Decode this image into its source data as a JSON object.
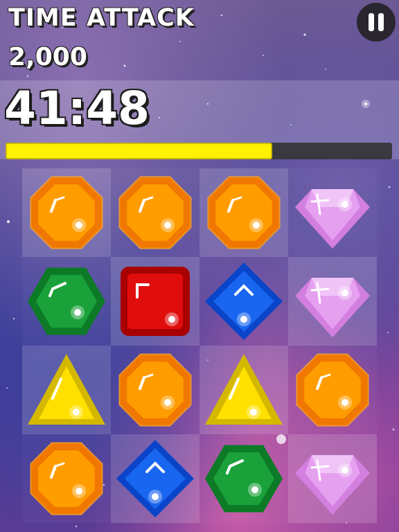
{
  "hud": {
    "title": "TIME ATTACK",
    "score": "2,000",
    "timer": "41:48",
    "time_remaining_fraction": 0.69
  },
  "colors": {
    "progress_fill": "#fff200",
    "orange_gem": "#ff9d00",
    "green_gem": "#1aa13a",
    "red_gem": "#e00d0d",
    "blue_gem": "#1966f0",
    "yellow_gem": "#ffe000",
    "pink_gem": "#e6a0f0"
  },
  "board": {
    "rows": [
      [
        "orange-octagon",
        "orange-octagon",
        "orange-octagon",
        "pink-diamond"
      ],
      [
        "green-hexagon",
        "red-square",
        "blue-rhombus",
        "pink-diamond"
      ],
      [
        "yellow-triangle",
        "orange-octagon",
        "yellow-triangle",
        "orange-octagon"
      ],
      [
        "orange-octagon",
        "blue-rhombus",
        "green-hexagon",
        "pink-diamond"
      ]
    ]
  }
}
